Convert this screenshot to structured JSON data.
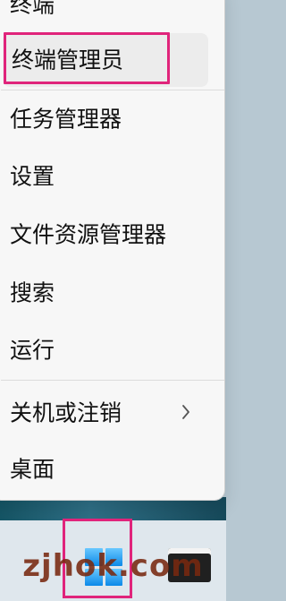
{
  "menu": {
    "items": [
      {
        "label": "终端"
      },
      {
        "label": "终端管理员"
      },
      {
        "label": "任务管理器"
      },
      {
        "label": "设置"
      },
      {
        "label": "文件资源管理器"
      },
      {
        "label": "搜索"
      },
      {
        "label": "运行"
      },
      {
        "label": "关机或注销"
      },
      {
        "label": "桌面"
      }
    ]
  },
  "icons": {
    "chevron": "chevron-right-icon",
    "windows": "windows-logo-icon",
    "app": "app-icon"
  },
  "watermark": {
    "text": "zjhok.com"
  },
  "colors": {
    "highlight": "#e0247b",
    "menu_bg": "#f7f7f7",
    "hover_bg": "#ececec",
    "taskbar_bg": "#dfe7ed",
    "windows_blue": "#0c89e8"
  }
}
